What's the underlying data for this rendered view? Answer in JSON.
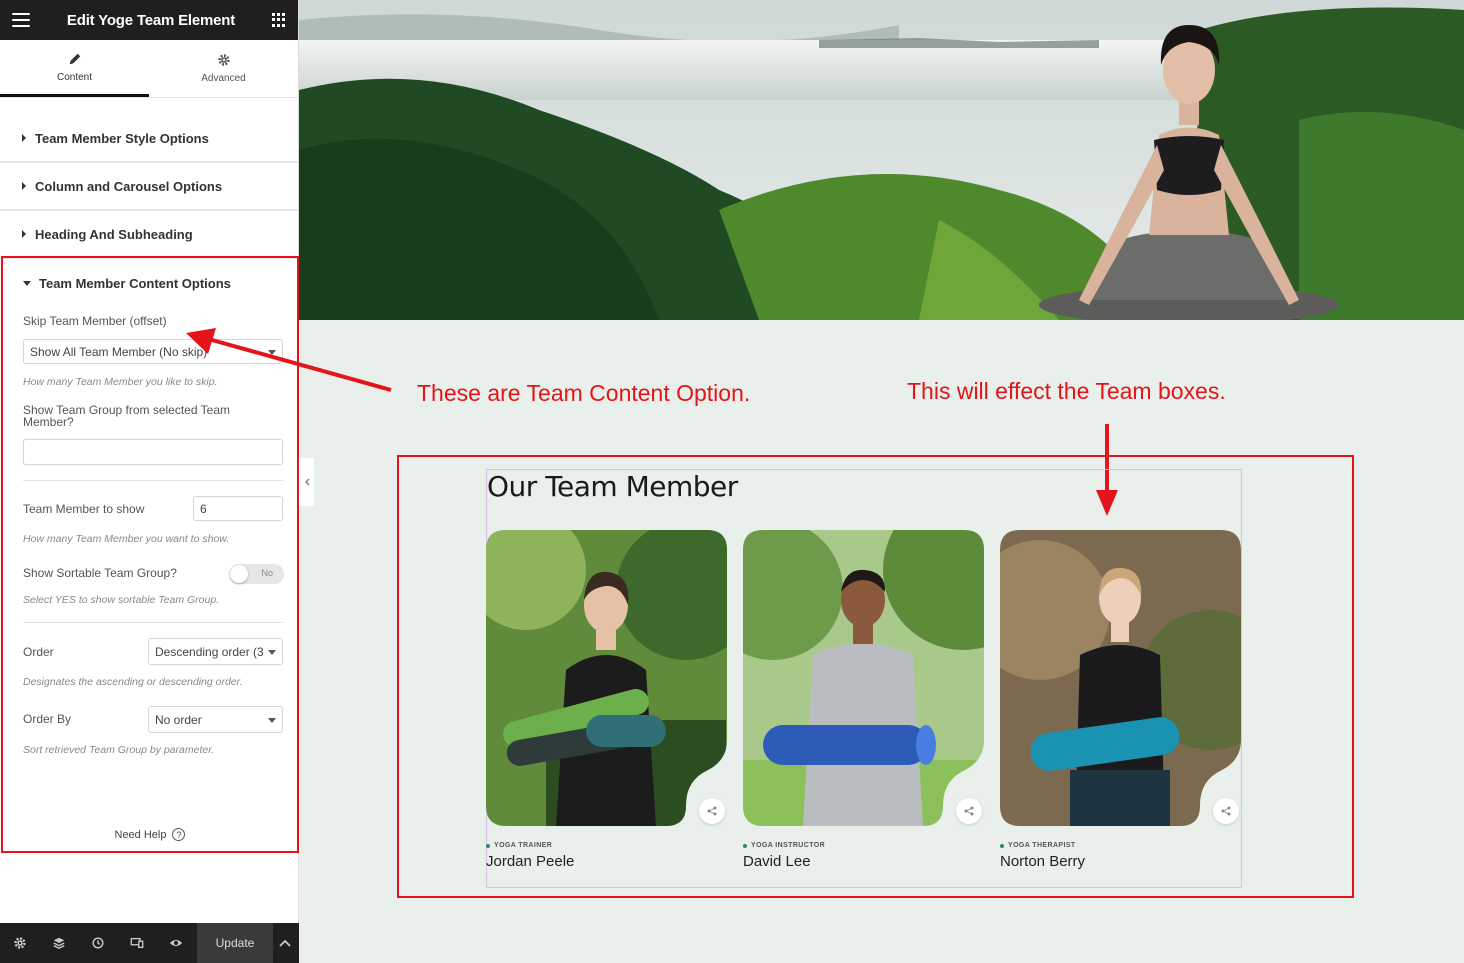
{
  "sidebar": {
    "title": "Edit Yoge Team Element",
    "tabs": [
      {
        "label": "Content",
        "icon": "pencil-icon",
        "active": true
      },
      {
        "label": "Advanced",
        "icon": "gear-icon",
        "active": false
      }
    ],
    "sections": [
      {
        "label": "Team Member Style Options"
      },
      {
        "label": "Column and Carousel Options"
      },
      {
        "label": "Heading And Subheading"
      }
    ],
    "content_options": {
      "title": "Team Member Content Options",
      "skip_label": "Skip Team Member (offset)",
      "skip_value": "Show All Team Member (No skip)",
      "skip_hint": "How many Team Member you like to skip.",
      "group_label": "Show Team Group from selected Team Member?",
      "group_value": "",
      "count_label": "Team Member to show",
      "count_value": "6",
      "count_hint": "How many Team Member you want to show.",
      "sortable_label": "Show Sortable Team Group?",
      "sortable_toggle": "No",
      "sortable_hint": "Select YES to show sortable Team Group.",
      "order_label": "Order",
      "order_value": "Descending order (3",
      "order_hint": "Designates the ascending or descending order.",
      "orderby_label": "Order By",
      "orderby_value": "No order",
      "orderby_hint": "Sort retrieved Team Group by parameter.",
      "need_help": "Need Help",
      "help_icon": "?"
    },
    "footer": {
      "icons": [
        "settings-icon",
        "layers-icon",
        "history-icon",
        "responsive-icon",
        "preview-icon"
      ],
      "update_label": "Update"
    }
  },
  "annotations": {
    "left": "These are Team Content Option.",
    "right": "This will effect the Team boxes.",
    "color": "#e4141b"
  },
  "team": {
    "heading": "Our Team Member",
    "members": [
      {
        "role": "YOGA TRAINER",
        "name": "Jordan Peele"
      },
      {
        "role": "YOGA INSTRUCTOR",
        "name": "David Lee"
      },
      {
        "role": "YOGA THERAPIST",
        "name": "Norton Berry"
      }
    ]
  }
}
